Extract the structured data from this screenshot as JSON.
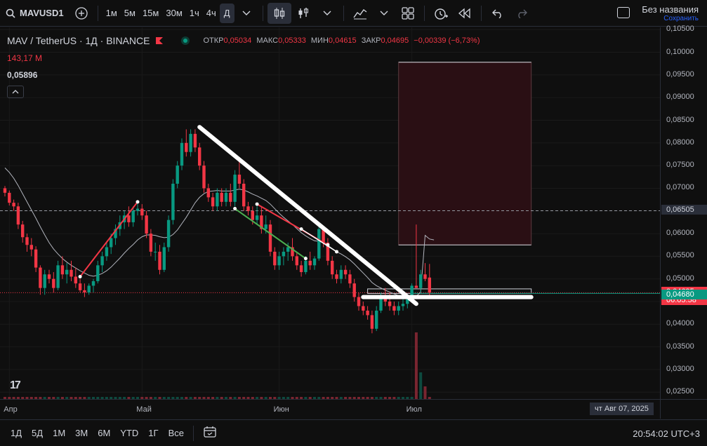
{
  "toolbar": {
    "symbol": "MAVUSD1",
    "timeframes": [
      "1м",
      "5м",
      "15м",
      "30м",
      "1ч",
      "4ч",
      "Д"
    ],
    "active_timeframe": "Д",
    "layout_name": "Без названия",
    "layout_status": "Сохранить"
  },
  "legend": {
    "title": "MAV / TetherUS · 1Д · BINANCE",
    "open_label": "ОТКР",
    "open": "0,05034",
    "high_label": "МАКС",
    "high": "0,05333",
    "low_label": "МИН",
    "low": "0,04615",
    "close_label": "ЗАКР",
    "close": "0,04695",
    "change": "−0,00339 (−6,73%)",
    "volume": "143,17 M",
    "ma_value": "0,05896"
  },
  "price_axis": {
    "labels": [
      "0,10500",
      "0,10000",
      "0,09500",
      "0,09000",
      "0,08500",
      "0,08000",
      "0,07500",
      "0,07000",
      "0,06500",
      "0,06000",
      "0,05500",
      "0,05000",
      "0,04500",
      "0,04000",
      "0,03500",
      "0,03000",
      "0,02500"
    ],
    "values": [
      0.105,
      0.1,
      0.095,
      0.09,
      0.085,
      0.08,
      0.075,
      0.07,
      0.065,
      0.06,
      0.055,
      0.05,
      0.045,
      0.04,
      0.035,
      0.03,
      0.025
    ],
    "hline_tag": "0,06505",
    "hline_value": 0.06505,
    "current_tag": "0,04695",
    "current_value": 0.04695,
    "countdown": "06:05:58",
    "green_tag": "0,04680",
    "green_value": 0.0468
  },
  "time_axis": {
    "labels": [
      "Апр",
      "Май",
      "Июн",
      "Июл"
    ],
    "label_days": [
      1,
      31,
      62,
      92
    ],
    "cursor_date": "чт Авг 07, 2025"
  },
  "bottom": {
    "ranges": [
      "1Д",
      "5Д",
      "1М",
      "3М",
      "6М",
      "YTD",
      "1Г",
      "Все"
    ],
    "clock": "20:54:02 UTC+3"
  },
  "colors": {
    "up": "#089981",
    "down": "#f23645",
    "bg": "#0f0f0f",
    "grid": "#1a1a1a",
    "accent": "#2962ff"
  },
  "chart_data": {
    "type": "candlestick",
    "ylim": [
      0.0235,
      0.1055
    ],
    "ohlc": [
      [
        0.07,
        0.0705,
        0.0682,
        0.069
      ],
      [
        0.069,
        0.0695,
        0.0662,
        0.0668
      ],
      [
        0.0668,
        0.0675,
        0.065,
        0.066
      ],
      [
        0.066,
        0.0668,
        0.061,
        0.062
      ],
      [
        0.062,
        0.0628,
        0.058,
        0.0592
      ],
      [
        0.0592,
        0.06,
        0.056,
        0.0575
      ],
      [
        0.0575,
        0.059,
        0.055,
        0.0565
      ],
      [
        0.0565,
        0.0572,
        0.0515,
        0.0525
      ],
      [
        0.0525,
        0.053,
        0.0465,
        0.048
      ],
      [
        0.048,
        0.052,
        0.0465,
        0.051
      ],
      [
        0.051,
        0.052,
        0.049,
        0.05
      ],
      [
        0.05,
        0.0515,
        0.047,
        0.048
      ],
      [
        0.048,
        0.054,
        0.0475,
        0.053
      ],
      [
        0.053,
        0.055,
        0.05,
        0.051
      ],
      [
        0.051,
        0.0535,
        0.049,
        0.052
      ],
      [
        0.052,
        0.054,
        0.0495,
        0.0505
      ],
      [
        0.0505,
        0.0525,
        0.048,
        0.049
      ],
      [
        0.049,
        0.05,
        0.047,
        0.0475
      ],
      [
        0.0475,
        0.049,
        0.046,
        0.047
      ],
      [
        0.047,
        0.049,
        0.0465,
        0.0485
      ],
      [
        0.0485,
        0.05,
        0.047,
        0.0495
      ],
      [
        0.0495,
        0.054,
        0.049,
        0.053
      ],
      [
        0.053,
        0.056,
        0.0515,
        0.055
      ],
      [
        0.055,
        0.058,
        0.054,
        0.057
      ],
      [
        0.057,
        0.06,
        0.0555,
        0.059
      ],
      [
        0.059,
        0.062,
        0.0575,
        0.061
      ],
      [
        0.061,
        0.064,
        0.0595,
        0.0625
      ],
      [
        0.0625,
        0.065,
        0.061,
        0.064
      ],
      [
        0.064,
        0.066,
        0.0615,
        0.0625
      ],
      [
        0.0625,
        0.066,
        0.0615,
        0.065
      ],
      [
        0.065,
        0.067,
        0.064,
        0.0655
      ],
      [
        0.0655,
        0.0665,
        0.063,
        0.064
      ],
      [
        0.064,
        0.065,
        0.059,
        0.06
      ],
      [
        0.06,
        0.061,
        0.055,
        0.056
      ],
      [
        0.056,
        0.058,
        0.054,
        0.056
      ],
      [
        0.056,
        0.0575,
        0.051,
        0.052
      ],
      [
        0.052,
        0.058,
        0.0515,
        0.057
      ],
      [
        0.057,
        0.064,
        0.056,
        0.063
      ],
      [
        0.063,
        0.072,
        0.062,
        0.071
      ],
      [
        0.071,
        0.076,
        0.07,
        0.075
      ],
      [
        0.075,
        0.081,
        0.074,
        0.08
      ],
      [
        0.08,
        0.083,
        0.077,
        0.078
      ],
      [
        0.078,
        0.083,
        0.077,
        0.082
      ],
      [
        0.082,
        0.083,
        0.078,
        0.079
      ],
      [
        0.079,
        0.08,
        0.074,
        0.075
      ],
      [
        0.075,
        0.076,
        0.069,
        0.07
      ],
      [
        0.07,
        0.071,
        0.067,
        0.068
      ],
      [
        0.068,
        0.069,
        0.065,
        0.066
      ],
      [
        0.066,
        0.07,
        0.065,
        0.069
      ],
      [
        0.069,
        0.07,
        0.066,
        0.067
      ],
      [
        0.067,
        0.07,
        0.066,
        0.069
      ],
      [
        0.069,
        0.071,
        0.066,
        0.067
      ],
      [
        0.067,
        0.074,
        0.066,
        0.073
      ],
      [
        0.073,
        0.076,
        0.07,
        0.071
      ],
      [
        0.071,
        0.072,
        0.065,
        0.066
      ],
      [
        0.066,
        0.067,
        0.064,
        0.065
      ],
      [
        0.065,
        0.066,
        0.062,
        0.063
      ],
      [
        0.063,
        0.066,
        0.062,
        0.064
      ],
      [
        0.064,
        0.066,
        0.06,
        0.061
      ],
      [
        0.061,
        0.064,
        0.06,
        0.062
      ],
      [
        0.062,
        0.063,
        0.055,
        0.056
      ],
      [
        0.056,
        0.057,
        0.052,
        0.053
      ],
      [
        0.053,
        0.056,
        0.052,
        0.055
      ],
      [
        0.055,
        0.057,
        0.053,
        0.056
      ],
      [
        0.056,
        0.058,
        0.054,
        0.057
      ],
      [
        0.057,
        0.059,
        0.054,
        0.055
      ],
      [
        0.055,
        0.056,
        0.052,
        0.053
      ],
      [
        0.053,
        0.054,
        0.0505,
        0.0515
      ],
      [
        0.0515,
        0.055,
        0.051,
        0.054
      ],
      [
        0.054,
        0.056,
        0.052,
        0.053
      ],
      [
        0.053,
        0.055,
        0.052,
        0.0545
      ],
      [
        0.0545,
        0.062,
        0.054,
        0.061
      ],
      [
        0.061,
        0.0615,
        0.057,
        0.058
      ],
      [
        0.058,
        0.059,
        0.053,
        0.054
      ],
      [
        0.054,
        0.055,
        0.05,
        0.051
      ],
      [
        0.051,
        0.052,
        0.049,
        0.05
      ],
      [
        0.05,
        0.053,
        0.049,
        0.052
      ],
      [
        0.052,
        0.053,
        0.05,
        0.051
      ],
      [
        0.051,
        0.052,
        0.048,
        0.049
      ],
      [
        0.049,
        0.05,
        0.045,
        0.046
      ],
      [
        0.046,
        0.047,
        0.043,
        0.044
      ],
      [
        0.044,
        0.045,
        0.042,
        0.043
      ],
      [
        0.043,
        0.044,
        0.041,
        0.042
      ],
      [
        0.042,
        0.043,
        0.038,
        0.039
      ],
      [
        0.039,
        0.044,
        0.0385,
        0.043
      ],
      [
        0.043,
        0.047,
        0.0425,
        0.046
      ],
      [
        0.046,
        0.048,
        0.044,
        0.045
      ],
      [
        0.045,
        0.047,
        0.043,
        0.044
      ],
      [
        0.044,
        0.045,
        0.042,
        0.043
      ],
      [
        0.043,
        0.045,
        0.042,
        0.044
      ],
      [
        0.044,
        0.046,
        0.043,
        0.0445
      ],
      [
        0.0445,
        0.0465,
        0.0435,
        0.0455
      ],
      [
        0.0455,
        0.049,
        0.045,
        0.0485
      ],
      [
        0.0485,
        0.062,
        0.048,
        0.048
      ],
      [
        0.048,
        0.052,
        0.047,
        0.051
      ],
      [
        0.051,
        0.0535,
        0.0495,
        0.05
      ],
      [
        0.0503,
        0.0533,
        0.0462,
        0.047
      ]
    ],
    "ma": [
      0.0745,
      0.0735,
      0.0722,
      0.0706,
      0.0688,
      0.067,
      0.0652,
      0.0634,
      0.0615,
      0.0597,
      0.058,
      0.0566,
      0.0555,
      0.0545,
      0.0537,
      0.053,
      0.0524,
      0.0518,
      0.0513,
      0.0508,
      0.0506,
      0.0508,
      0.0512,
      0.0518,
      0.0526,
      0.0536,
      0.0546,
      0.0557,
      0.0567,
      0.0576,
      0.0586,
      0.0593,
      0.0597,
      0.0597,
      0.0596,
      0.0593,
      0.0591,
      0.0592,
      0.0598,
      0.0608,
      0.0622,
      0.0636,
      0.0652,
      0.0668,
      0.068,
      0.0688,
      0.0693,
      0.0694,
      0.0695,
      0.0694,
      0.0694,
      0.0694,
      0.0696,
      0.0698,
      0.0696,
      0.0692,
      0.0687,
      0.0683,
      0.0678,
      0.0673,
      0.0665,
      0.0655,
      0.0645,
      0.0636,
      0.0628,
      0.062,
      0.0611,
      0.0602,
      0.0595,
      0.0589,
      0.0584,
      0.0583,
      0.058,
      0.0574,
      0.0567,
      0.056,
      0.0555,
      0.0549,
      0.0542,
      0.0533,
      0.0523,
      0.0513,
      0.0503,
      0.0492,
      0.0485,
      0.048,
      0.0475,
      0.0471,
      0.0467,
      0.0463,
      0.046,
      0.0457,
      0.0456,
      0.0462,
      0.0471,
      0.0596,
      0.0588,
      0.0586
    ]
  },
  "drawings": {
    "trendline_white": [
      [
        44,
        0.0835
      ],
      [
        93,
        0.0445
      ]
    ],
    "red_line_1": [
      [
        17,
        0.0505
      ],
      [
        30,
        0.067
      ]
    ],
    "red_line_2": [
      [
        57,
        0.0665
      ],
      [
        73,
        0.0575
      ]
    ],
    "green_line": [
      [
        52,
        0.0655
      ],
      [
        68,
        0.0545
      ]
    ],
    "white_line_short": [
      [
        67,
        0.061
      ],
      [
        75,
        0.056
      ]
    ],
    "hline_white": [
      [
        81,
        0.046
      ],
      [
        119,
        0.046
      ]
    ],
    "rect_upper": {
      "x0": 89,
      "x1": 119,
      "y0": 0.0575,
      "y1": 0.0978
    },
    "rect_lower": {
      "x0": 82,
      "x1": 119,
      "y0": 0.0468,
      "y1": 0.0478
    },
    "rect_line": 0.0575
  }
}
